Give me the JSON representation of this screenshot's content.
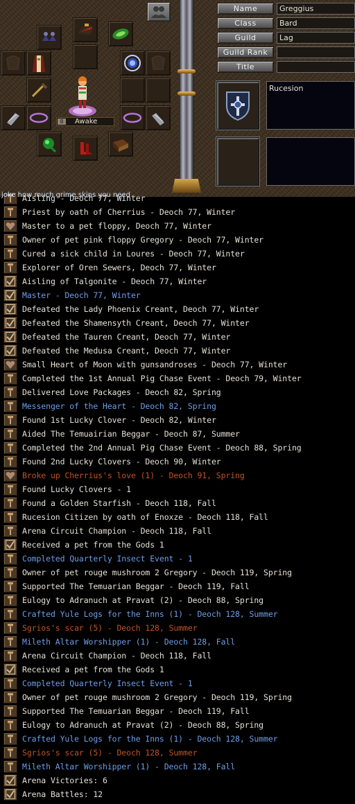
{
  "header_scroll_text": "joke how much grime skins you need",
  "character": {
    "status": "Awake",
    "status_number": "8"
  },
  "profile": {
    "fields": [
      {
        "label": "Name",
        "value": "Greggius"
      },
      {
        "label": "Class",
        "value": "Bard"
      },
      {
        "label": "Guild",
        "value": "Lag"
      },
      {
        "label": "Guild Rank",
        "value": ""
      },
      {
        "label": "Title",
        "value": ""
      }
    ],
    "nation": "Rucesion"
  },
  "equipment_slots": [
    "earring-left-icon",
    "helmet-icon",
    "leaf-shield-icon",
    "empty",
    "armor-slot-empty-icon",
    "overcoat-icon",
    "blue-gem-ring-icon",
    "armor-slot-empty-icon",
    "weapon-icon",
    "empty",
    "empty",
    "gauntlet-left-icon",
    "bracelet-left-icon",
    "bracelet-right-icon",
    "gauntlet-right-icon",
    "green-charm-icon",
    "red-boots-icon",
    "book-icon"
  ],
  "legend": [
    {
      "icon": "legend-mark-icon",
      "color": "white",
      "text": "Aisling - Deoch 77, Winter"
    },
    {
      "icon": "legend-mark-icon",
      "color": "white",
      "text": "Priest by oath of Cherrius - Deoch 77, Winter"
    },
    {
      "icon": "heart-mark-icon",
      "color": "white",
      "text": "Master to a pet floppy, Deoch 77, Winter"
    },
    {
      "icon": "legend-mark-icon",
      "color": "white",
      "text": "Owner of pet pink floppy Gregory - Deoch 77, Winter"
    },
    {
      "icon": "legend-mark-icon",
      "color": "white",
      "text": "Cured a sick child in Loures - Deoch 77, Winter"
    },
    {
      "icon": "legend-mark-icon",
      "color": "white",
      "text": "Explorer of Oren Sewers, Deoch 77, Winter"
    },
    {
      "icon": "check-mark-icon",
      "color": "white",
      "text": "Aisling of Talgonite - Deoch 77, Winter"
    },
    {
      "icon": "check-mark-icon",
      "color": "blue",
      "text": "Master - Deoch 77, Winter"
    },
    {
      "icon": "check-mark-icon",
      "color": "white",
      "text": "Defeated the Lady Phoenix Creant, Deoch 77, Winter"
    },
    {
      "icon": "check-mark-icon",
      "color": "white",
      "text": "Defeated the Shamensyth Creant, Deoch 77, Winter"
    },
    {
      "icon": "check-mark-icon",
      "color": "white",
      "text": "Defeated the Tauren Creant, Deoch 77, Winter"
    },
    {
      "icon": "check-mark-icon",
      "color": "white",
      "text": "Defeated the Medusa Creant, Deoch 77, Winter"
    },
    {
      "icon": "heart-mark-icon",
      "color": "white",
      "text": "Small Heart of Moon with gunsandroses - Deoch 77, Winter"
    },
    {
      "icon": "legend-mark-icon",
      "color": "white",
      "text": "Completed the 1st Annual Pig Chase Event - Deoch 79, Winter"
    },
    {
      "icon": "legend-mark-icon",
      "color": "white",
      "text": "Delivered Love Packages - Deoch 82, Spring"
    },
    {
      "icon": "legend-mark-icon",
      "color": "blue",
      "text": "Messenger of the Heart - Deoch 82, Spring"
    },
    {
      "icon": "legend-mark-icon",
      "color": "white",
      "text": "Found 1st Lucky Clover - Deoch 82, Winter"
    },
    {
      "icon": "legend-mark-icon",
      "color": "white",
      "text": "Aided The Temuairian Beggar - Deoch 87, Summer"
    },
    {
      "icon": "legend-mark-icon",
      "color": "white",
      "text": "Completed the 2nd Annual Pig Chase Event - Deoch 88, Spring"
    },
    {
      "icon": "legend-mark-icon",
      "color": "white",
      "text": "Found 2nd Lucky Clovers - Deoch 90, Winter"
    },
    {
      "icon": "heart-mark-icon",
      "color": "orange",
      "text": "Broke up Cherrius's love (1) - Deoch 91, Spring"
    },
    {
      "icon": "legend-mark-icon",
      "color": "white",
      "text": "Found Lucky Clovers - 1"
    },
    {
      "icon": "legend-mark-icon",
      "color": "white",
      "text": "Found a Golden Starfish - Deoch 118, Fall"
    },
    {
      "icon": "legend-mark-icon",
      "color": "white",
      "text": "Rucesion Citizen by oath of Enoxze - Deoch 118, Fall"
    },
    {
      "icon": "legend-mark-icon",
      "color": "white",
      "text": "Arena Circuit Champion - Deoch 118, Fall"
    },
    {
      "icon": "check-mark-icon",
      "color": "white",
      "text": "Received a pet from the Gods 1"
    },
    {
      "icon": "legend-mark-icon",
      "color": "blue",
      "text": "Completed Quarterly Insect Event - 1"
    },
    {
      "icon": "legend-mark-icon",
      "color": "white",
      "text": "Owner of pet rouge mushroom 2 Gregory - Deoch 119, Spring"
    },
    {
      "icon": "legend-mark-icon",
      "color": "white",
      "text": "Supported The Temuarian Beggar - Deoch 119, Fall"
    },
    {
      "icon": "legend-mark-icon",
      "color": "white",
      "text": "Eulogy to Adranuch at Pravat (2) - Deoch 88, Spring"
    },
    {
      "icon": "legend-mark-icon",
      "color": "blue",
      "text": "Crafted Yule Logs for the Inns (1) - Deoch 128, Summer"
    },
    {
      "icon": "legend-mark-icon",
      "color": "orange",
      "text": "Sgrios's scar (5) - Deoch 128, Summer"
    },
    {
      "icon": "legend-mark-icon",
      "color": "blue",
      "text": "Mileth Altar Worshipper (1) - Deoch 128, Fall"
    },
    {
      "icon": "legend-mark-icon",
      "color": "white",
      "text": "Arena Circuit Champion - Deoch 118, Fall"
    },
    {
      "icon": "check-mark-icon",
      "color": "white",
      "text": "Received a pet from the Gods 1"
    },
    {
      "icon": "legend-mark-icon",
      "color": "blue",
      "text": "Completed Quarterly Insect Event - 1"
    },
    {
      "icon": "legend-mark-icon",
      "color": "white",
      "text": "Owner of pet rouge mushroom 2 Gregory - Deoch 119, Spring"
    },
    {
      "icon": "legend-mark-icon",
      "color": "white",
      "text": "Supported The Temuarian Beggar - Deoch 119, Fall"
    },
    {
      "icon": "legend-mark-icon",
      "color": "white",
      "text": "Eulogy to Adranuch at Pravat (2) - Deoch 88, Spring"
    },
    {
      "icon": "legend-mark-icon",
      "color": "blue",
      "text": "Crafted Yule Logs for the Inns (1) - Deoch 128, Summer"
    },
    {
      "icon": "legend-mark-icon",
      "color": "orange",
      "text": "Sgrios's scar (5) - Deoch 128, Summer"
    },
    {
      "icon": "legend-mark-icon",
      "color": "blue",
      "text": "Mileth Altar Worshipper (1) - Deoch 128, Fall"
    },
    {
      "icon": "check-mark-icon",
      "color": "white",
      "text": "Arena Victories: 6"
    },
    {
      "icon": "check-mark-icon",
      "color": "white",
      "text": "Arena Battles: 12"
    }
  ],
  "colors": {
    "white": "#e4e1d6",
    "blue": "#6f9ee8",
    "orange": "#c05428"
  }
}
